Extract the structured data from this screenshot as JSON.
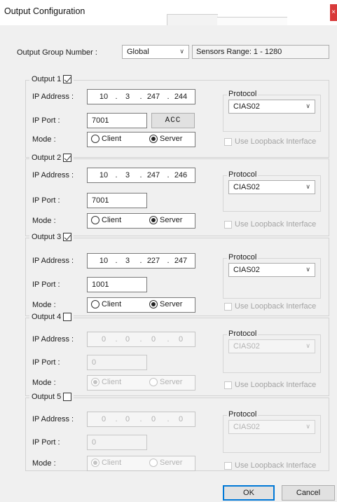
{
  "window": {
    "title": "Output Configuration",
    "close_glyph": "×"
  },
  "header": {
    "group_label": "Output Group Number :",
    "group_value": "Global",
    "range_text": "Sensors Range: 1 - 1280"
  },
  "labels": {
    "ip_address": "IP Address :",
    "ip_port": "IP Port :",
    "mode": "Mode :",
    "client": "Client",
    "server": "Server",
    "protocol": "Protocol",
    "loopback": "Use Loopback Interface",
    "dot": "."
  },
  "outputs": [
    {
      "title": "Output 1",
      "checked": true,
      "ip": [
        "10",
        "3",
        "247",
        "244"
      ],
      "port": "7001",
      "acc_label": "ACC",
      "mode": "server",
      "protocol": "CIAS02"
    },
    {
      "title": "Output 2",
      "checked": true,
      "ip": [
        "10",
        "3",
        "247",
        "246"
      ],
      "port": "7001",
      "mode": "server",
      "protocol": "CIAS02"
    },
    {
      "title": "Output 3",
      "checked": true,
      "ip": [
        "10",
        "3",
        "227",
        "247"
      ],
      "port": "1001",
      "mode": "server",
      "protocol": "CIAS02"
    },
    {
      "title": "Output 4",
      "checked": false,
      "ip": [
        "0",
        "0",
        "0",
        "0"
      ],
      "port": "0",
      "mode": "client",
      "protocol": "CIAS02"
    },
    {
      "title": "Output 5",
      "checked": false,
      "ip": [
        "0",
        "0",
        "0",
        "0"
      ],
      "port": "0",
      "mode": "client",
      "protocol": "CIAS02"
    }
  ],
  "buttons": {
    "ok": "OK",
    "cancel": "Cancel"
  },
  "icons": {
    "chevron": "chevron-down-icon",
    "checkbox": "checkmark-icon"
  }
}
